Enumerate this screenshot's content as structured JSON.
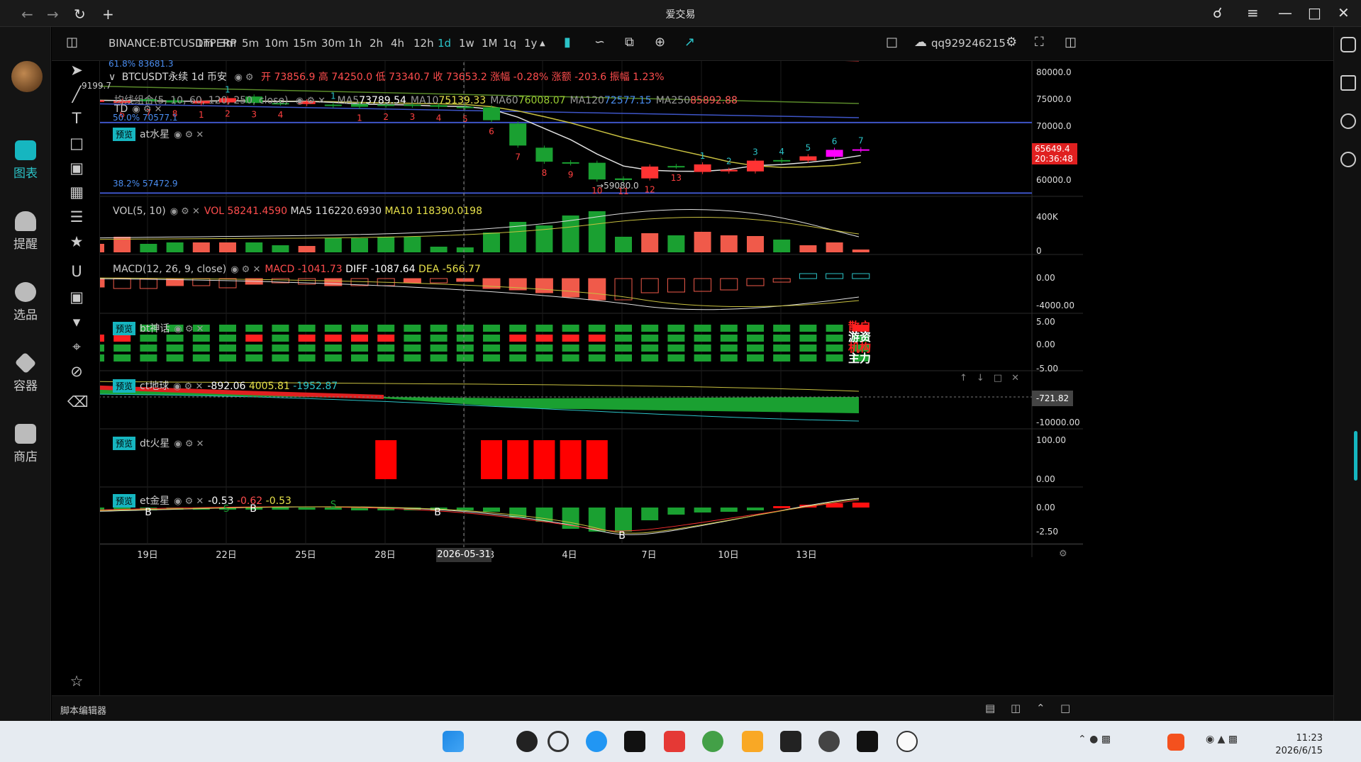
{
  "window": {
    "title": "爱交易"
  },
  "app_rail": {
    "items": [
      {
        "label": "图表",
        "icon": "chart-icon",
        "active": true
      },
      {
        "label": "提醒",
        "icon": "bell-icon",
        "active": false
      },
      {
        "label": "选品",
        "icon": "search-chart-icon",
        "active": false
      },
      {
        "label": "容器",
        "icon": "container-icon",
        "active": false
      },
      {
        "label": "商店",
        "icon": "store-icon",
        "active": false
      }
    ]
  },
  "toolbar": {
    "symbol": "BINANCE:BTCUSDTPERP",
    "intervals": [
      "1m",
      "3m",
      "5m",
      "10m",
      "15m",
      "30m",
      "1h",
      "2h",
      "4h",
      "12h",
      "1d",
      "1w",
      "1M",
      "1q",
      "1y"
    ],
    "active_interval": "1d",
    "user": "qq929246215"
  },
  "main_pane": {
    "title": "BTCUSDT永续 1d 币安",
    "ohlc_text": "开 73856.9 高 74250.0 低 73340.7 收 73653.2 涨幅 -0.28% 涨额 -203.6 振幅 1.23%",
    "fib_top": "61.8% 83681.3",
    "fib_mid": "50.0% 70577.1",
    "fib_low": "38.2% 57472.9",
    "left_price": "9199.7",
    "ma_name": "均线组合(5, 10, 60, 120, 250, close)",
    "ma_values": [
      {
        "label": "MA5",
        "value": "73789.54",
        "color": "#ffffff"
      },
      {
        "label": "MA10",
        "value": "75139.33",
        "color": "#e6e04a"
      },
      {
        "label": "MA60",
        "value": "76008.07",
        "color": "#9acd32"
      },
      {
        "label": "MA120",
        "value": "72577.15",
        "color": "#4a8df0"
      },
      {
        "label": "MA250",
        "value": "85892.88",
        "color": "#ff5a5a"
      }
    ],
    "td_label": "TD",
    "at_label": "at水星",
    "preview_tag": "预览",
    "low_label": "59080.0",
    "price_tag": "65649.4",
    "countdown": "20:36:48",
    "axis_ticks": [
      "80000.0",
      "75000.0",
      "70000.0",
      "65000.0",
      "60000.0"
    ]
  },
  "vol_pane": {
    "name": "VOL(5, 10)",
    "vol": "VOL 58241.4590",
    "ma5": "MA5 116220.6930",
    "ma10": "MA10 118390.0198",
    "axis_ticks": [
      "400K",
      "0"
    ]
  },
  "macd_pane": {
    "name": "MACD(12, 26, 9, close)",
    "macd": "MACD -1041.73",
    "diff": "DIFF -1087.64",
    "dea": "DEA -566.77",
    "axis_ticks": [
      "0.00",
      "-4000.00"
    ]
  },
  "bt_pane": {
    "name": "bt神话",
    "row_labels": [
      "散户",
      "游资",
      "机构",
      "主力"
    ],
    "axis_ticks": [
      "5.00",
      "0.00",
      "-5.00"
    ]
  },
  "ct_pane": {
    "name": "ct地球",
    "v1": "-892.06",
    "v2": "4005.81",
    "v3": "-1952.87",
    "axis_ticks": [
      "-10000.00"
    ],
    "price_tag": "-721.82"
  },
  "dt_pane": {
    "name": "dt火星",
    "axis_ticks": [
      "100.00",
      "0.00"
    ]
  },
  "et_pane": {
    "name": "et金星",
    "v1": "-0.53",
    "v2": "-0.62",
    "v3": "-0.53",
    "axis_ticks": [
      "0.00",
      "-2.50"
    ]
  },
  "time_axis": {
    "labels": [
      "19日",
      "22日",
      "25日",
      "28日",
      "3",
      "4日",
      "7日",
      "10日",
      "13日"
    ],
    "crosshair_date": "2026-05-31"
  },
  "bottom": {
    "script_editor": "脚本编辑器"
  },
  "taskbar": {
    "time": "11:23",
    "date": "2026/6/15"
  },
  "chart_data": {
    "type": "candlestick",
    "series": [
      {
        "o": 74400,
        "c": 74700
      },
      {
        "o": 74200,
        "c": 74600
      },
      {
        "o": 74900,
        "c": 74500
      },
      {
        "o": 74700,
        "c": 74300
      },
      {
        "o": 74100,
        "c": 74600
      },
      {
        "o": 74300,
        "c": 75100
      },
      {
        "o": 75400,
        "c": 74200
      },
      {
        "o": 74200,
        "c": 74100
      },
      {
        "o": 74000,
        "c": 74500
      },
      {
        "o": 73900,
        "c": 73700
      },
      {
        "o": 74000,
        "c": 73500
      },
      {
        "o": 73900,
        "c": 73700
      },
      {
        "o": 73900,
        "c": 73700
      },
      {
        "o": 73800,
        "c": 73500
      },
      {
        "o": 73500,
        "c": 73300
      },
      {
        "o": 73400,
        "c": 71000
      },
      {
        "o": 70400,
        "c": 66300
      },
      {
        "o": 65900,
        "c": 63300
      },
      {
        "o": 63200,
        "c": 63000
      },
      {
        "o": 63100,
        "c": 60000
      },
      {
        "o": 60200,
        "c": 59900
      },
      {
        "o": 60200,
        "c": 62400
      },
      {
        "o": 62500,
        "c": 62400
      },
      {
        "o": 61400,
        "c": 62800
      },
      {
        "o": 61500,
        "c": 61800
      },
      {
        "o": 61500,
        "c": 63500
      },
      {
        "o": 63600,
        "c": 63400
      },
      {
        "o": 63500,
        "c": 64300
      },
      {
        "o": 64200,
        "c": 65500
      },
      {
        "o": 65400,
        "c": 65600
      }
    ]
  }
}
